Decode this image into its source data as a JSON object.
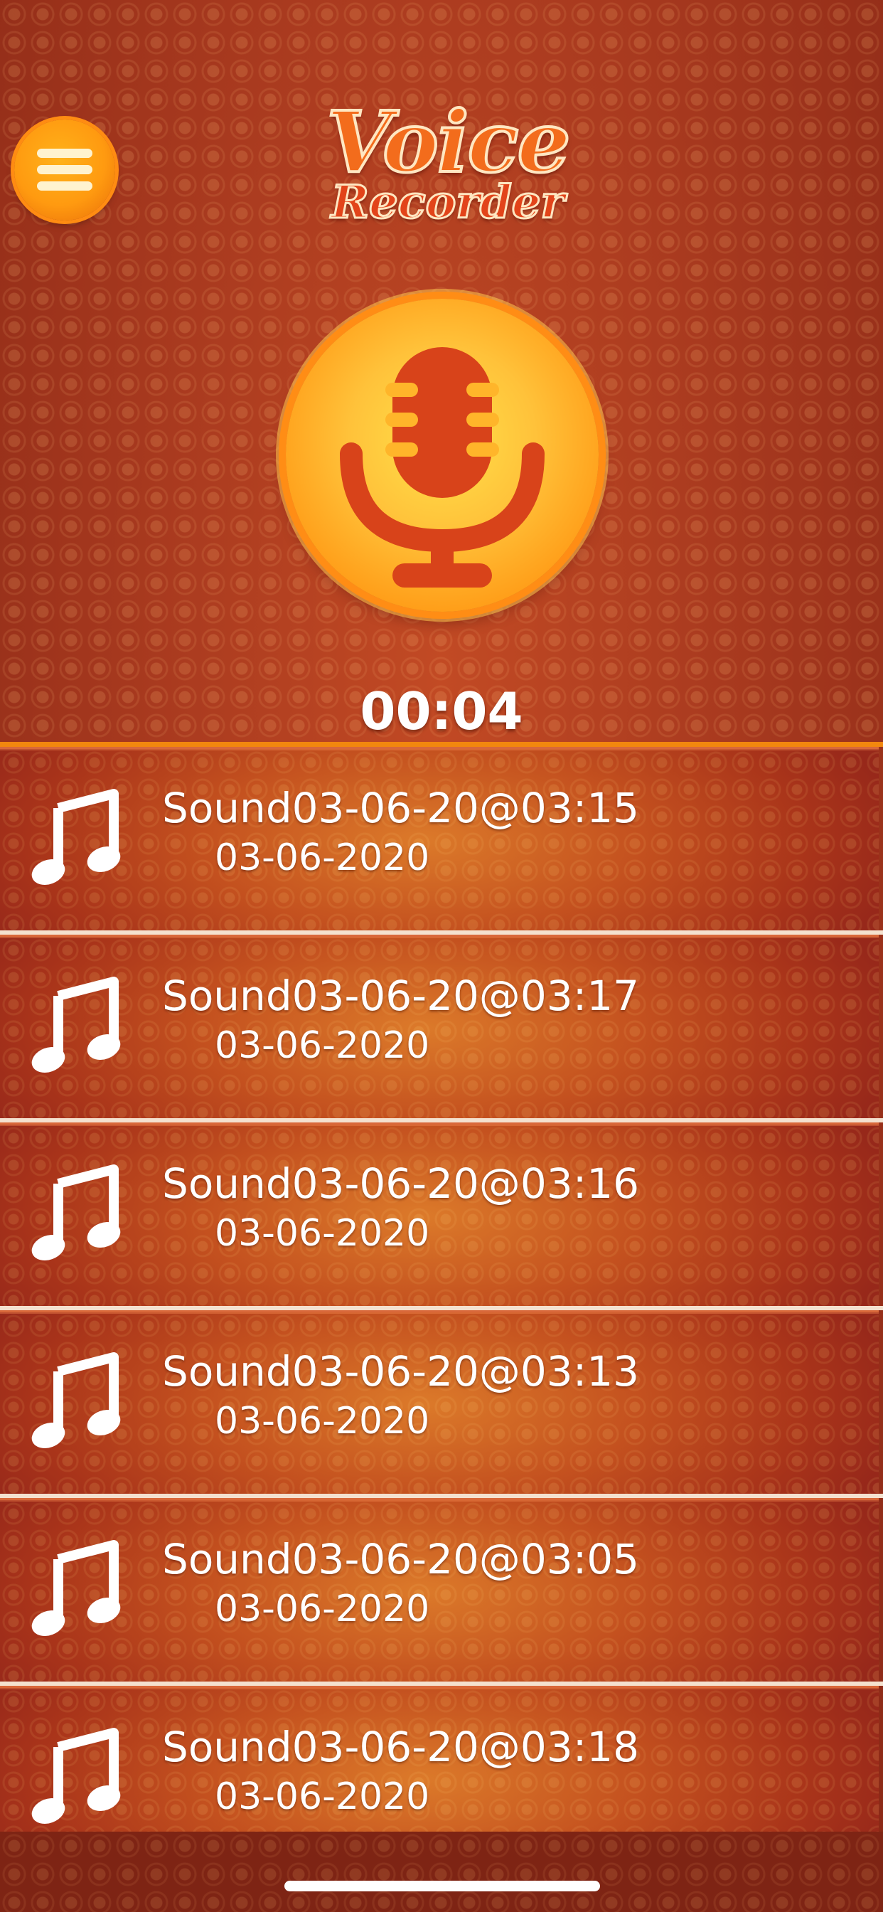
{
  "app": {
    "title_line1": "Voice",
    "title_line2": "Recorder"
  },
  "header": {
    "menu_icon": "hamburger-menu-icon",
    "record_icon": "microphone-icon",
    "timer": "00:04"
  },
  "colors": {
    "accent": "#ff9a10",
    "background": "#a8321c",
    "text": "#ffffff"
  },
  "recordings": [
    {
      "name": "Sound03-06-20@03:15",
      "date": "03-06-2020",
      "icon": "music-note-icon"
    },
    {
      "name": "Sound03-06-20@03:17",
      "date": "03-06-2020",
      "icon": "music-note-icon"
    },
    {
      "name": "Sound03-06-20@03:16",
      "date": "03-06-2020",
      "icon": "music-note-icon"
    },
    {
      "name": "Sound03-06-20@03:13",
      "date": "03-06-2020",
      "icon": "music-note-icon"
    },
    {
      "name": "Sound03-06-20@03:05",
      "date": "03-06-2020",
      "icon": "music-note-icon"
    },
    {
      "name": "Sound03-06-20@03:18",
      "date": "03-06-2020",
      "icon": "music-note-icon"
    }
  ]
}
